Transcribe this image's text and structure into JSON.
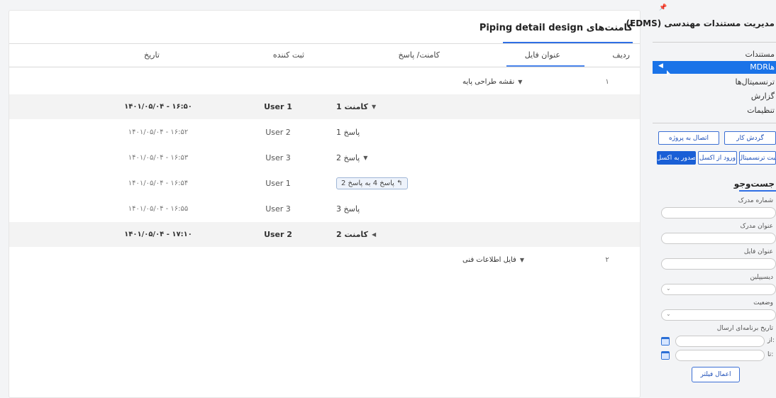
{
  "main": {
    "title": "کامنت‌های Piping detail design",
    "columns": {
      "row_no": "ردیف",
      "file_title": "عنوان فایل",
      "comment_reply": "کامنت/ پاسخ",
      "registrant": "ثبت کننده",
      "date": "تاریخ"
    },
    "rows": [
      {
        "type": "file",
        "num": "۱",
        "file": "نقشه طراحی پایه",
        "caret": "▼"
      },
      {
        "type": "comment",
        "comment": "کامنت 1",
        "caret": "▼",
        "user": "User 1",
        "date": "۱۴۰۱/۰۵/۰۴  -  ۱۶:۵۰"
      },
      {
        "type": "reply",
        "comment": "پاسخ 1",
        "user": "User 2",
        "date": "۱۴۰۱/۰۵/۰۴  -  ۱۶:۵۲"
      },
      {
        "type": "reply",
        "comment": "پاسخ 2",
        "caret": "▼",
        "user": "User 3",
        "date": "۱۴۰۱/۰۵/۰۴  -  ۱۶:۵۳"
      },
      {
        "type": "reply-chip",
        "comment": "↰ پاسخ 4 به پاسخ 2",
        "user": "User 1",
        "date": "۱۴۰۱/۰۵/۰۴  -  ۱۶:۵۴"
      },
      {
        "type": "reply",
        "comment": "پاسخ 3",
        "user": "User 3",
        "date": "۱۴۰۱/۰۵/۰۴  -  ۱۶:۵۵"
      },
      {
        "type": "comment",
        "comment": "کامنت 2",
        "caret": "◀",
        "user": "User 2",
        "date": "۱۴۰۱/۰۵/۰۴  -  ۱۷:۱۰"
      },
      {
        "type": "file",
        "num": "۲",
        "file": "فایل اطلاعات فنی",
        "caret": "▼"
      }
    ]
  },
  "sidebar": {
    "pin_icon": "📌",
    "title": "مدیریت مستندات مهندسی (EDMS)",
    "nav": {
      "documents": "مستندات",
      "mdr": "MDRها",
      "transmittals": "ترنسمیتال‌ها",
      "report": "گزارش",
      "settings": "تنظیمات"
    },
    "buttons": {
      "workflow": "گردش کار",
      "connect_project": "اتصال به پروژه",
      "register_transmittal": "ثبت ترنسمیتال",
      "import_excel": "ورود از اکسل",
      "export_excel": "صدور به اکسل"
    },
    "search": {
      "title": "جست‌وجو",
      "doc_number": "شماره مدرک",
      "doc_title": "عنوان مدرک",
      "file_title": "عنوان فایل",
      "discipline": "دیسیپلین",
      "status": "وضعیت",
      "send_schedule_date": "تاریخ برنامه‌ای ارسال",
      "from": "از:",
      "to": "تا:",
      "apply": "اعمال فیلتر"
    }
  },
  "colors": {
    "accent": "#1a73e8",
    "row_gray": "#f3f3f3"
  }
}
